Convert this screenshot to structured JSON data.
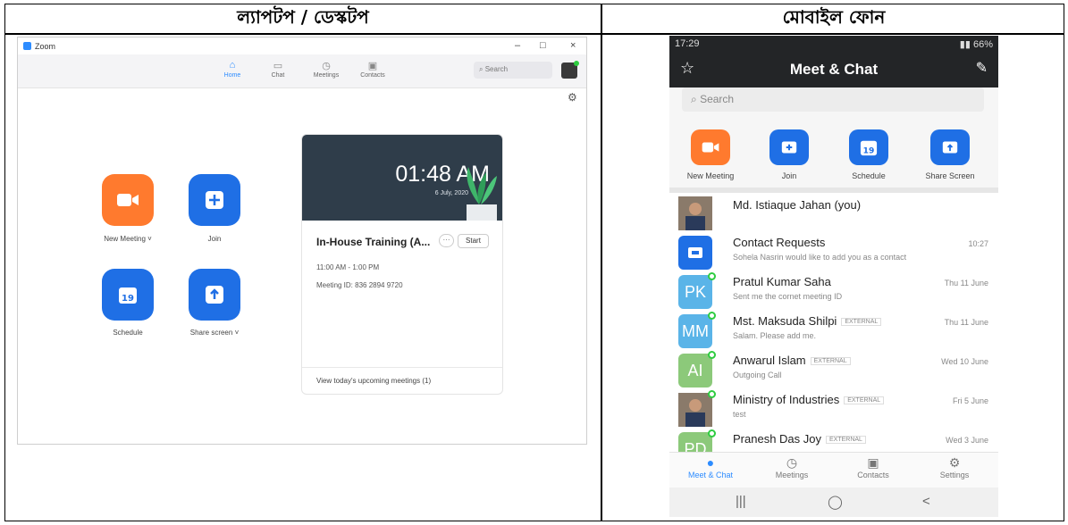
{
  "table": {
    "desktop_heading": "ল্যাপটপ / ডেস্কটপ",
    "mobile_heading": "মোবাইল ফোন"
  },
  "desktop": {
    "window_title": "Zoom",
    "window_controls": {
      "minimize": "–",
      "maximize": "□",
      "close": "×"
    },
    "tabs": [
      {
        "label": "Home",
        "icon": "home-icon",
        "active": true
      },
      {
        "label": "Chat",
        "icon": "chat-icon",
        "active": false
      },
      {
        "label": "Meetings",
        "icon": "clock-icon",
        "active": false
      },
      {
        "label": "Contacts",
        "icon": "contacts-icon",
        "active": false
      }
    ],
    "search_placeholder": "Search",
    "actions": [
      {
        "label": "New Meeting",
        "color": "#ff7a2e",
        "icon": "video-camera-icon",
        "dropdown": true
      },
      {
        "label": "Join",
        "color": "#1f6fe5",
        "icon": "plus-icon",
        "dropdown": false
      },
      {
        "label": "Schedule",
        "color": "#1f6fe5",
        "icon": "calendar-icon",
        "dropdown": false,
        "badge": "19"
      },
      {
        "label": "Share screen",
        "color": "#1f6fe5",
        "icon": "share-up-arrow-icon",
        "dropdown": true
      }
    ],
    "card": {
      "time": "01:48 AM",
      "date": "6 July, 2020",
      "meeting_title": "In-House Training (A...",
      "more_label": "···",
      "start_label": "Start",
      "meeting_time": "11:00 AM - 1:00 PM",
      "meeting_id": "Meeting ID: 836 2894 9720",
      "footer": "View today's upcoming meetings (1)"
    }
  },
  "mobile": {
    "status_time": "17:29",
    "status_right": "66%",
    "title": "Meet & Chat",
    "search_placeholder": "Search",
    "actions": [
      {
        "label": "New Meeting",
        "color": "#ff7a2e",
        "icon": "video-camera-icon"
      },
      {
        "label": "Join",
        "color": "#1f6fe5",
        "icon": "plus-icon"
      },
      {
        "label": "Schedule",
        "color": "#1f6fe5",
        "icon": "calendar-icon",
        "badge": "19"
      },
      {
        "label": "Share Screen",
        "color": "#1f6fe5",
        "icon": "share-up-arrow-icon"
      }
    ],
    "contacts": [
      {
        "name": "Md. Istiaque Jahan (you)",
        "initials": "",
        "avatar_color": "#6a5a4a",
        "photo": true,
        "message": "",
        "time": "",
        "external": "",
        "online": false
      },
      {
        "name": "Contact Requests",
        "initials": "",
        "avatar_color": "#1f6fe5",
        "photo": false,
        "icon": true,
        "message": "Sohela Nasrin would like to add you as a contact",
        "time": "10:27",
        "external": "",
        "online": false
      },
      {
        "name": "Pratul Kumar Saha",
        "initials": "PK",
        "avatar_color": "#5ab4e8",
        "photo": false,
        "message": "Sent me the cornet meeting ID",
        "time": "Thu 11 June",
        "external": "",
        "online": true
      },
      {
        "name": "Mst. Maksuda Shilpi",
        "initials": "MM",
        "avatar_color": "#5ab4e8",
        "photo": false,
        "message": "Salam. Please add me.",
        "time": "Thu 11 June",
        "external": "EXTERNAL",
        "online": true
      },
      {
        "name": "Anwarul Islam",
        "initials": "AI",
        "avatar_color": "#8cc97a",
        "photo": false,
        "message": "Outgoing Call",
        "time": "Wed 10 June",
        "external": "EXTERNAL",
        "online": true
      },
      {
        "name": "Ministry of Industries",
        "initials": "",
        "avatar_color": "#6a5a4a",
        "photo": true,
        "message": "test",
        "time": "Fri 5 June",
        "external": "EXTERNAL",
        "online": true
      },
      {
        "name": "Pranesh Das Joy",
        "initials": "PD",
        "avatar_color": "#8cc97a",
        "photo": false,
        "message": "",
        "time": "Wed 3 June",
        "external": "EXTERNAL",
        "online": true
      }
    ],
    "bottom_nav": [
      {
        "label": "Meet & Chat",
        "icon": "chat-bubble-icon",
        "active": true
      },
      {
        "label": "Meetings",
        "icon": "clock-icon",
        "active": false
      },
      {
        "label": "Contacts",
        "icon": "contacts-icon",
        "active": false
      },
      {
        "label": "Settings",
        "icon": "gear-icon",
        "active": false
      }
    ],
    "system_nav": {
      "recent": "|||",
      "home": "◯",
      "back": "<"
    }
  }
}
